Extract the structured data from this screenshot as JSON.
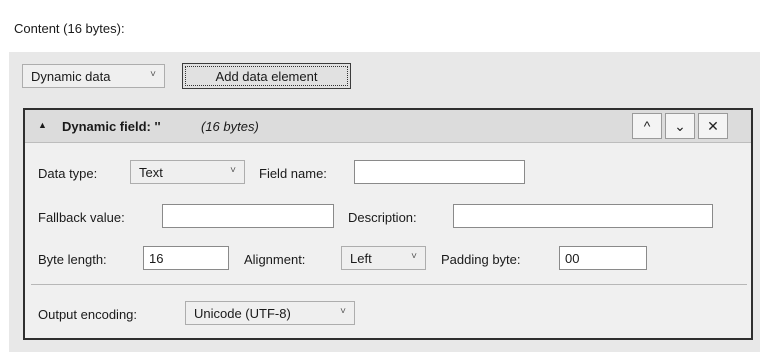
{
  "content_label": "Content (16 bytes):",
  "toolbar": {
    "type_select": "Dynamic data",
    "add_button": "Add data element"
  },
  "field": {
    "title": "Dynamic field: ''",
    "size": "(16 bytes)",
    "controls": {
      "up": "^",
      "down": "⌄",
      "close": "✕"
    },
    "data_type_label": "Data type:",
    "data_type_value": "Text",
    "field_name_label": "Field name:",
    "field_name_value": "",
    "fallback_label": "Fallback value:",
    "fallback_value": "",
    "description_label": "Description:",
    "description_value": "",
    "byte_length_label": "Byte length:",
    "byte_length_value": "16",
    "alignment_label": "Alignment:",
    "alignment_value": "Left",
    "padding_label": "Padding byte:",
    "padding_value": "00",
    "encoding_label": "Output encoding:",
    "encoding_value": "Unicode (UTF-8)"
  },
  "icons": {
    "collapse": "triangle-up-icon",
    "dropdown": "chevron-down-icon"
  }
}
